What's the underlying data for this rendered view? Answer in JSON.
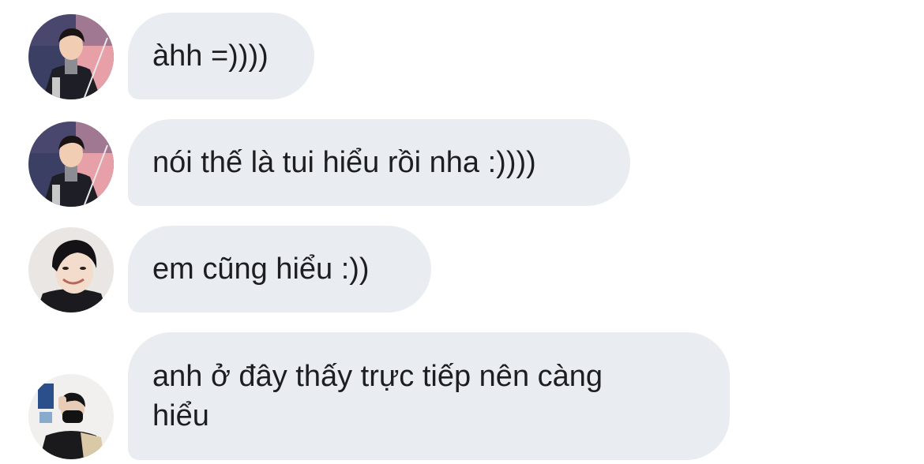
{
  "messages": [
    {
      "text": "àhh =))))",
      "sender_avatar": "avatar-man-in-suit-with-award"
    },
    {
      "text": "nói thế là tui hiểu rồi nha :))))",
      "sender_avatar": "avatar-man-in-suit-with-award"
    },
    {
      "text": "em cũng hiểu :))",
      "sender_avatar": "avatar-young-man-smiling"
    },
    {
      "text": "anh ở đây thấy trực tiếp nên càng\nhiểu",
      "sender_avatar": "avatar-person-with-mask"
    }
  ],
  "colors": {
    "bubble_background": "#e9edf1",
    "text": "#1c1e21",
    "page_background": "#ffffff"
  }
}
